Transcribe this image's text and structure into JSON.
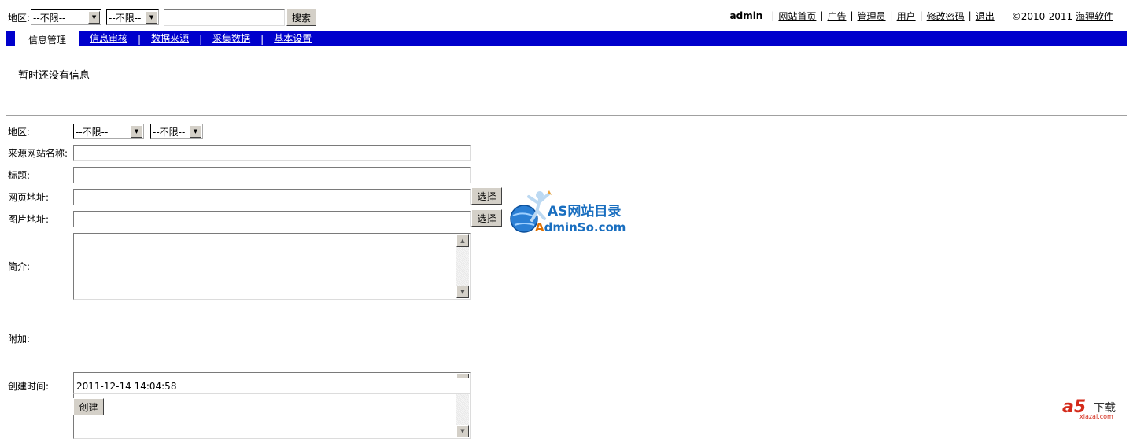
{
  "search": {
    "region_label": "地区:",
    "region1_value": "--不限--",
    "region2_value": "--不限--",
    "keyword_value": "",
    "search_button": "搜索"
  },
  "user_nav": {
    "username": "admin",
    "links": [
      "网站首页",
      "广告",
      "管理员",
      "用户",
      "修改密码",
      "退出"
    ],
    "separator": "|",
    "copyright_prefix": "©2010-2011",
    "copyright_link": "海狸软件"
  },
  "main_nav": {
    "active_tab": "信息管理",
    "tabs": [
      "信息审核",
      "数据来源",
      "采集数据",
      "基本设置"
    ],
    "separator": "|"
  },
  "content": {
    "empty_message": "暂时还没有信息"
  },
  "form": {
    "region_label": "地区:",
    "region1_value": "--不限--",
    "region2_value": "--不限--",
    "source_name_label": "来源网站名称:",
    "source_name_value": "",
    "title_label": "标题:",
    "title_value": "",
    "url_label": "网页地址:",
    "url_value": "",
    "url_select_button": "选择",
    "image_label": "图片地址:",
    "image_value": "",
    "image_select_button": "选择",
    "summary_label": "简介:",
    "summary_value": "",
    "extra_label": "附加:",
    "extra_value": "",
    "created_label": "创建时间:",
    "created_value": "2011-12-14 14:04:58",
    "create_button": "创建"
  },
  "watermarks": {
    "as_title": "AS网站目录",
    "as_domain_a": "A",
    "as_domain_rest": "dminSo.com",
    "a5_mark": "a5",
    "a5_text": "下载",
    "a5_domain": "xiazai.com"
  },
  "colors": {
    "nav_blue": "#0000cc",
    "logo_blue": "#1a6fc0",
    "logo_orange": "#e07000",
    "a5_red": "#d42a1a"
  }
}
